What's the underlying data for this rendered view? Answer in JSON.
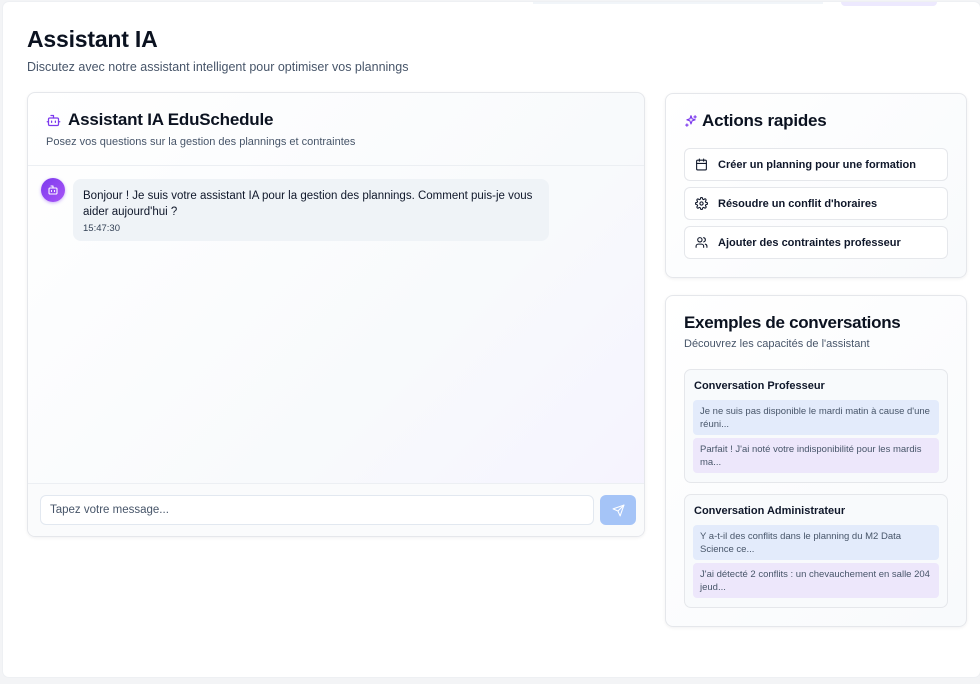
{
  "page": {
    "title": "Assistant IA",
    "subtitle": "Discutez avec notre assistant intelligent pour optimiser vos plannings"
  },
  "chat": {
    "title": "Assistant IA EduSchedule",
    "subtitle": "Posez vos questions sur la gestion des plannings et contraintes",
    "messages": [
      {
        "role": "assistant",
        "text": "Bonjour ! Je suis votre assistant IA pour la gestion des plannings. Comment puis-je vous aider aujourd'hui ?",
        "time": "15:47:30"
      }
    ],
    "input": {
      "placeholder": "Tapez votre message...",
      "value": ""
    },
    "send_icon": "send-icon"
  },
  "quick_actions": {
    "title": "Actions rapides",
    "icon": "sparkles-icon",
    "items": [
      {
        "label": "Créer un planning pour une formation",
        "icon": "calendar-icon"
      },
      {
        "label": "Résoudre un conflit d'horaires",
        "icon": "gear-icon"
      },
      {
        "label": "Ajouter des contraintes professeur",
        "icon": "users-icon"
      }
    ]
  },
  "examples": {
    "title": "Exemples de conversations",
    "subtitle": "Découvrez les capacités de l'assistant",
    "conversations": [
      {
        "title": "Conversation Professeur",
        "user_msg": "Je ne suis pas disponible le mardi matin à cause d'une réuni...",
        "bot_msg": "Parfait ! J'ai noté votre indisponibilité pour les mardis ma..."
      },
      {
        "title": "Conversation Administrateur",
        "user_msg": "Y a-t-il des conflits dans le planning du M2 Data Science ce...",
        "bot_msg": "J'ai détecté 2 conflits : un chevauchement en salle 204 jeud..."
      }
    ]
  },
  "colors": {
    "accent": "#7c3aed",
    "send_button": "#a5c4f7",
    "user_bubble": "#e3ebfb",
    "bot_bubble": "#ede7fb"
  }
}
